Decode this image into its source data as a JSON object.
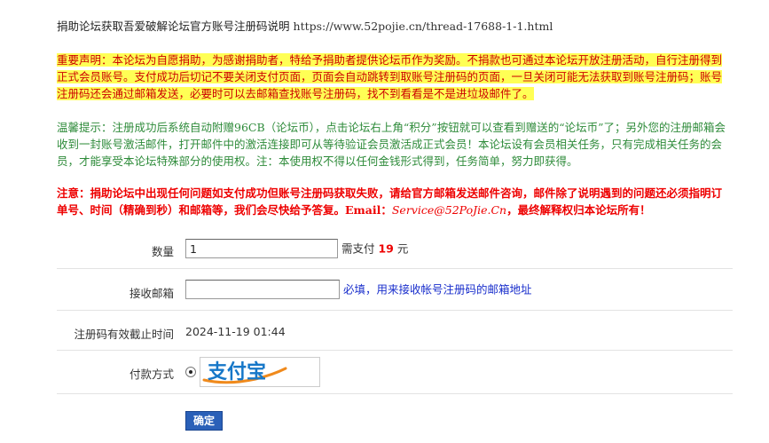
{
  "header": {
    "title": "捐助论坛获取吾爱破解论坛官方账号注册码说明",
    "link": "https://www.52pojie.cn/thread-17688-1-1.html"
  },
  "notice": {
    "text": "重要声明：本论坛为自愿捐助，为感谢捐助者，特给予捐助者提供论坛币作为奖励。不捐款也可通过本论坛开放注册活动，自行注册得到正式会员账号。支付成功后切记不要关闭支付页面，页面会自动跳转到取账号注册码的页面，一旦关闭可能无法获取到账号注册码；账号注册码还会通过邮箱发送，必要时可以去邮箱查找账号注册码，找不到看看是不是进垃圾邮件了。"
  },
  "tip": {
    "text": "温馨提示：注册成功后系统自动附赠96CB（论坛币），点击论坛右上角“积分”按钮就可以查看到赠送的“论坛币”了；另外您的注册邮箱会收到一封账号激活邮件，打开邮件中的激活连接即可从等待验证会员激活成正式会员！本论坛设有会员相关任务，只有完成相关任务的会员，才能享受本论坛特殊部分的使用权。注：本使用权不得以任何金钱形式得到，任务简单，努力即获得。"
  },
  "warning": {
    "text_before": "注意：捐助论坛中出现任何问题如支付成功但账号注册码获取失败，请给官方邮箱发送邮件咨询，邮件除了说明遇到的问题还必须指明订单号、时间（精确到秒）和邮箱等，我们会尽快给予答复。Email：",
    "email": "Service@52PoJie.Cn",
    "text_after": "，最终解释权归本论坛所有！"
  },
  "form": {
    "quantity": {
      "label": "数量",
      "value": "1",
      "pay_prefix": "需支付",
      "price": "19",
      "unit": "元"
    },
    "email": {
      "label": "接收邮箱",
      "value": "",
      "hint": "必填，用来接收帐号注册码的邮箱地址"
    },
    "expiry": {
      "label": "注册码有效截止时间",
      "value": "2024-11-19 01:44"
    },
    "payment": {
      "label": "付款方式",
      "option": "支付宝",
      "selected": true
    },
    "submit_label": "确定"
  },
  "colors": {
    "notice_text": "#cc0000",
    "notice_highlight": "#ffff55",
    "tip_text": "#2e8b3a",
    "warning_text": "#ee0000",
    "hint_text": "#1a2fcc",
    "button_bg": "#2a60b8",
    "alipay_blue": "#1677c8",
    "alipay_orange": "#f08a1c"
  },
  "icons": {
    "payment_logo": "alipay-logo"
  }
}
